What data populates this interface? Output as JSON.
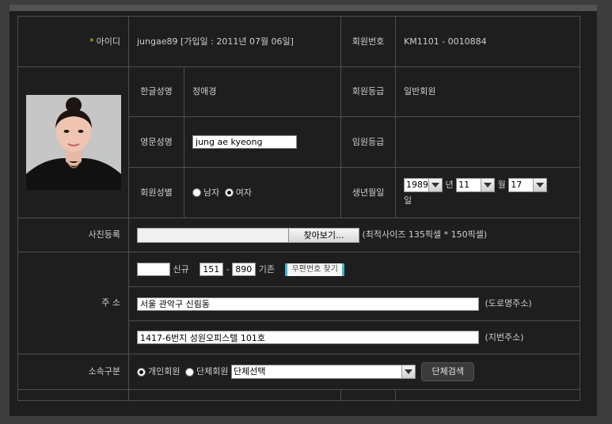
{
  "member": {
    "id_label": "아이디",
    "id_required_mark": "*",
    "id_value": "jungae89 [가입일 : 2011년 07월 06일]",
    "member_no_label": "회원번호",
    "member_no_value": "KM1101 - 0010884",
    "kor_name_label": "한글성명",
    "kor_name_value": "정애경",
    "grade_label": "회원등급",
    "grade_value": "일반회원",
    "eng_name_label": "영문성명",
    "eng_name_value": "jung ae kyeong",
    "officer_label": "임원등급",
    "officer_value": "",
    "gender_label": "회원성별",
    "gender_options": [
      "남자",
      "여자"
    ],
    "gender_selected": "여자",
    "birth_label": "생년월일",
    "birth_year": "1989",
    "birth_year_unit": "년",
    "birth_month": "11",
    "birth_month_unit": "월",
    "birth_day": "17",
    "birth_day_unit": "일"
  },
  "photo": {
    "label": "사진등록",
    "browse_button": "찾아보기...",
    "hint": "(최적사이즈 135픽셀 * 150픽셀)"
  },
  "address": {
    "label": "주 소",
    "new_zip_value": "",
    "new_zip_label": "신규",
    "old_zip_1": "151",
    "old_zip_dash": "-",
    "old_zip_2": "890",
    "old_zip_label": "기존",
    "find_zip_button": "우편번호 찾기",
    "road_address": "서울 관악구 신림동",
    "road_address_label": "(도로명주소)",
    "lot_address": "1417-6번지 성원오피스텔 101호",
    "lot_address_label": "(지번주소)"
  },
  "affiliation": {
    "label": "소속구분",
    "options": [
      "개인회원",
      "단체회원"
    ],
    "selected": "개인회원",
    "group_select_value": "단체선택",
    "group_search_button": "단체검색"
  },
  "colors": {
    "background": "#1e1e1e",
    "border": "#4e4e4e",
    "accent": "#3fb7d0",
    "required": "#f2c200"
  }
}
